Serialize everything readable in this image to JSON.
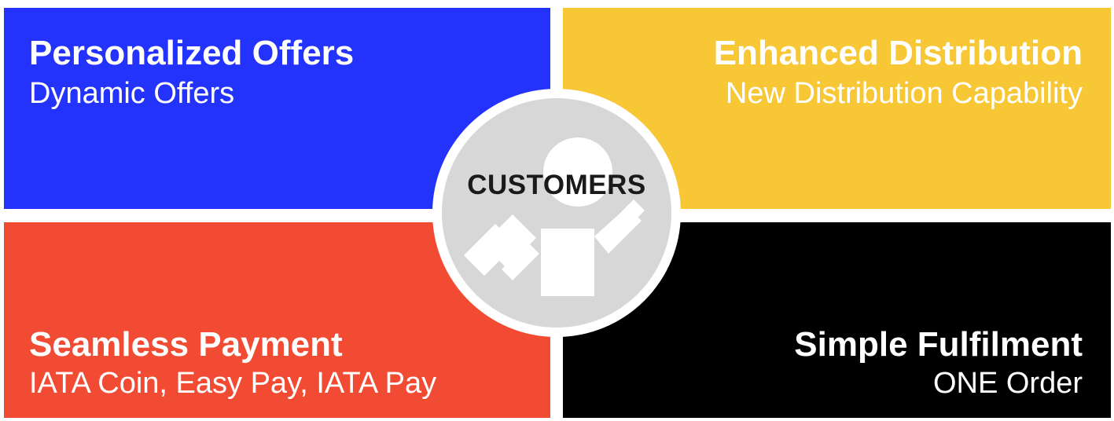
{
  "colors": {
    "top_left": "#2333fc",
    "top_right": "#f8c735",
    "bottom_left": "#f24b34",
    "bottom_right": "#000000",
    "circle_fill": "#d7d7d7",
    "circle_ring": "#ffffff",
    "figure": "#ffffff",
    "label": "#1a1a1a"
  },
  "quadrants": {
    "top_left": {
      "title": "Personalized Offers",
      "subtitle": "Dynamic Offers",
      "title_color": "#ffffff",
      "subtitle_color": "#ffffff"
    },
    "top_right": {
      "title": "Enhanced Distribution",
      "subtitle": "New Distribution Capability",
      "title_color": "#ffffff",
      "subtitle_color": "#ffffff"
    },
    "bottom_left": {
      "title": "Seamless Payment",
      "subtitle": "IATA Coin, Easy Pay, IATA Pay",
      "title_color": "#ffffff",
      "subtitle_color": "#ffffff"
    },
    "bottom_right": {
      "title": "Simple Fulfilment",
      "subtitle": "ONE Order",
      "title_color": "#ffffff",
      "subtitle_color": "#ffffff"
    }
  },
  "center": {
    "label": "CUSTOMERS",
    "icon": "person-with-shapes-icon"
  }
}
